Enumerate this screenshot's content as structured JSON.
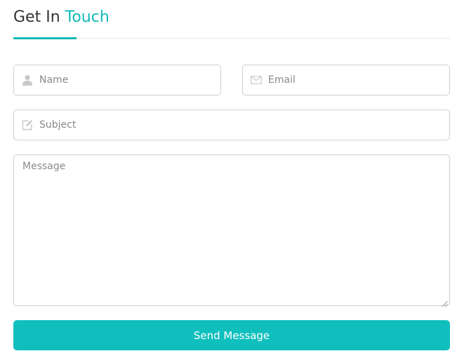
{
  "header": {
    "title_prefix": "Get In",
    "title_accent": "Touch"
  },
  "colors": {
    "accent": "#12b9b9",
    "button": "#0fbfbd",
    "text": "#333333",
    "placeholder": "#8a8a8a",
    "border": "#cfcfcf"
  },
  "form": {
    "name": {
      "placeholder": "Name",
      "icon": "user-icon",
      "value": ""
    },
    "email": {
      "placeholder": "Email",
      "icon": "envelope-icon",
      "value": ""
    },
    "subject": {
      "placeholder": "Subject",
      "icon": "edit-icon",
      "value": ""
    },
    "message": {
      "placeholder": "Message",
      "value": ""
    },
    "submit_label": "Send Message"
  }
}
